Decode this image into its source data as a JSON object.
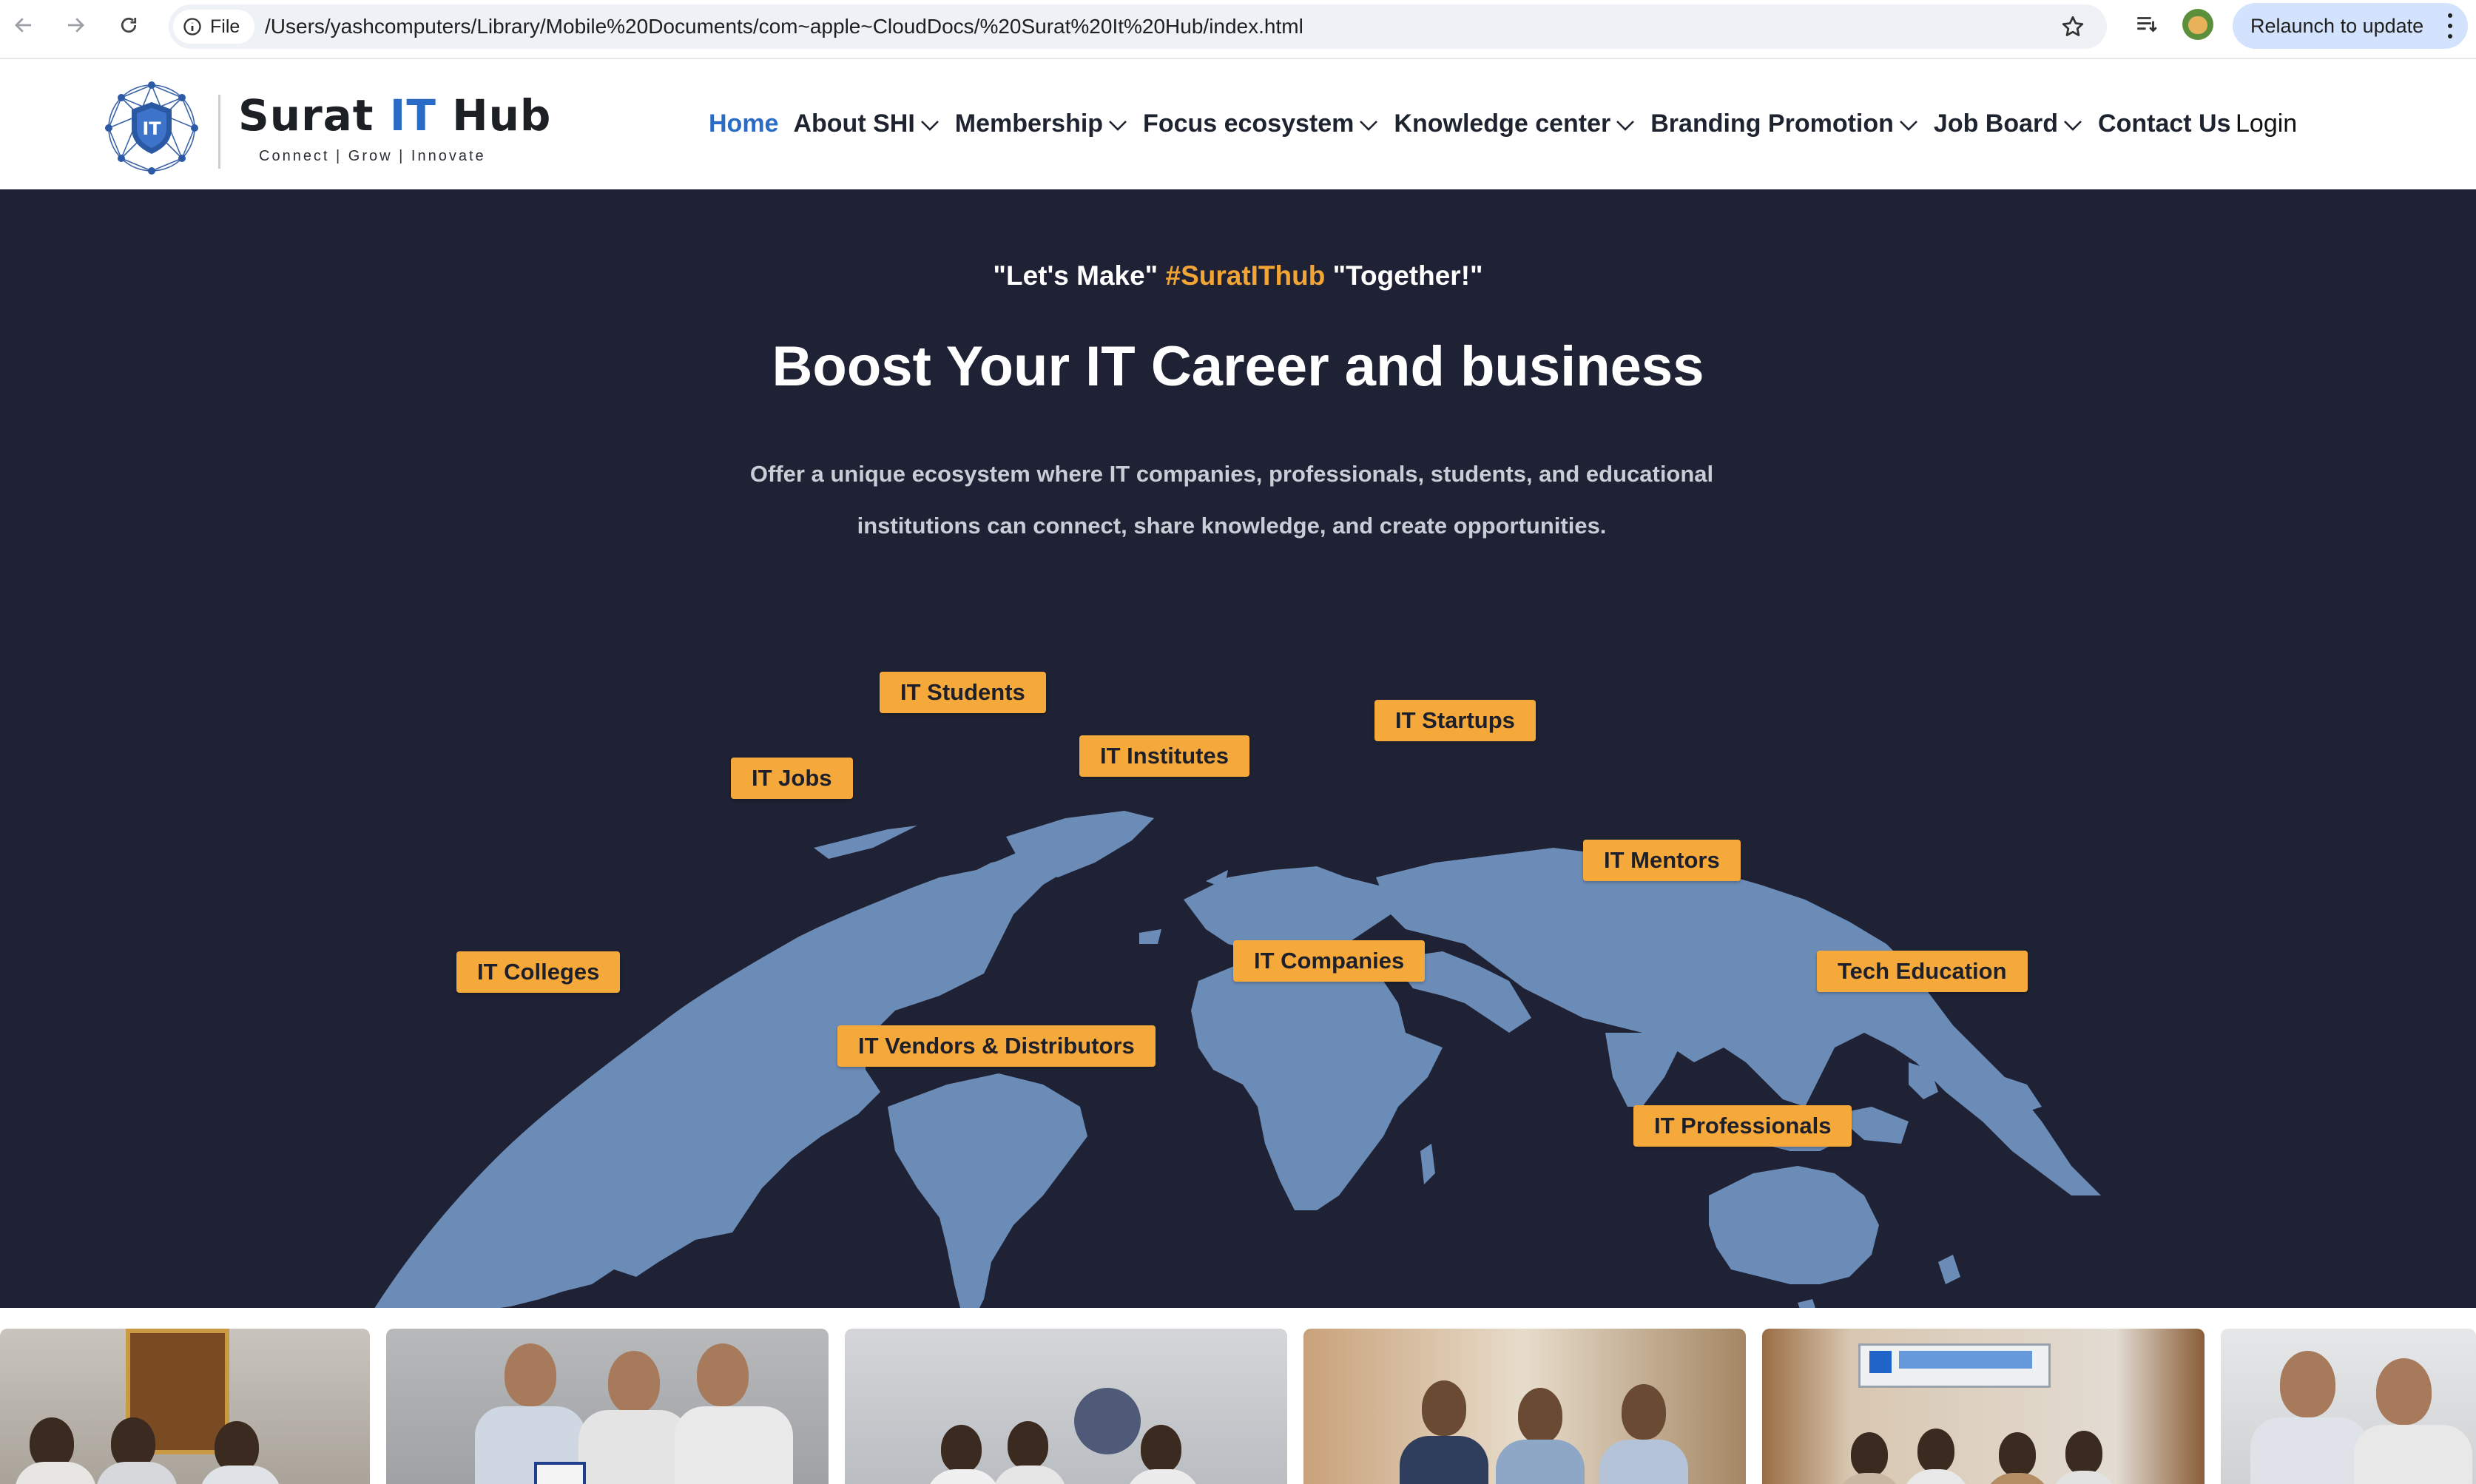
{
  "browser": {
    "file_chip": "File",
    "url": "/Users/yashcomputers/Library/Mobile%20Documents/com~apple~CloudDocs/%20Surat%20It%20Hub/index.html",
    "relaunch_label": "Relaunch to update"
  },
  "site": {
    "logo": {
      "name_pre": "Surat ",
      "name_it": "IT",
      "name_post": " Hub",
      "tagline": "Connect | Grow | Innovate",
      "badge": "IT"
    },
    "nav": [
      {
        "label": "Home",
        "active": true
      },
      {
        "label": "About SHI",
        "dropdown": true
      },
      {
        "label": "Membership",
        "dropdown": true
      },
      {
        "label": "Focus ecosystem",
        "dropdown": true
      },
      {
        "label": "Knowledge center",
        "dropdown": true
      },
      {
        "label": "Branding Promotion",
        "dropdown": true
      },
      {
        "label": "Job Board",
        "dropdown": true
      },
      {
        "label": "Contact Us"
      }
    ],
    "login_label": "Login"
  },
  "hero": {
    "tagline_pre": "\"Let's Make\" ",
    "tagline_hash": "#SuratIThub",
    "tagline_post": " \"Together!\"",
    "headline": "Boost Your IT Career and business",
    "lead_line1": "Offer a unique ecosystem where IT companies, professionals, students, and educational",
    "lead_line2": "institutions can connect, share knowledge, and create opportunities.",
    "tags": [
      "IT Students",
      "IT Startups",
      "IT Jobs",
      "IT Institutes",
      "IT Mentors",
      "IT Colleges",
      "IT Companies",
      "Tech Education",
      "IT Vendors & Distributors",
      "IT Professionals"
    ]
  },
  "gallery": {
    "photo_count": 6
  },
  "colors": {
    "hero_bg": "#1e2234",
    "accent_orange": "#f6a93b",
    "link_blue": "#2a6bc5",
    "map_blue": "#6c8cb8"
  }
}
